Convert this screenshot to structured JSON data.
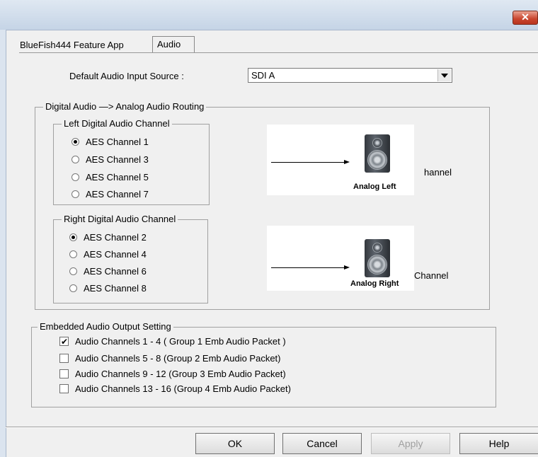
{
  "window": {
    "close_label": "✕"
  },
  "tabs": [
    {
      "label": "BlueFish444 Feature App"
    },
    {
      "label": "Audio"
    }
  ],
  "input_source": {
    "label": "Default Audio Input Source :",
    "value": "SDI A"
  },
  "routing": {
    "title": "Digital Audio —> Analog Audio Routing",
    "left": {
      "title": "Left Digital Audio Channel",
      "options": [
        "AES Channel 1",
        "AES Channel 3",
        "AES Channel 5",
        "AES Channel 7"
      ],
      "selected": "AES Channel 1",
      "speaker_label": "Analog Left",
      "side_text": "hannel"
    },
    "right": {
      "title": "Right Digital Audio Channel",
      "options": [
        "AES Channel 2",
        "AES Channel 4",
        "AES Channel 6",
        "AES Channel 8"
      ],
      "selected": "AES Channel 2",
      "speaker_label": "Analog Right",
      "side_text": "Channel"
    }
  },
  "embedded": {
    "title": "Embedded Audio Output Setting",
    "items": [
      {
        "label": "Audio Channels 1 - 4 ( Group 1 Emb Audio Packet )",
        "checked": true
      },
      {
        "label": "Audio Channels 5 - 8  (Group 2 Emb Audio Packet)",
        "checked": false
      },
      {
        "label": "Audio Channels 9 - 12  (Group 3 Emb Audio Packet)",
        "checked": false
      },
      {
        "label": "Audio Channels 13 - 16  (Group 4 Emb Audio Packet)",
        "checked": false
      }
    ]
  },
  "buttons": {
    "ok": "OK",
    "cancel": "Cancel",
    "apply": "Apply",
    "help": "Help"
  }
}
